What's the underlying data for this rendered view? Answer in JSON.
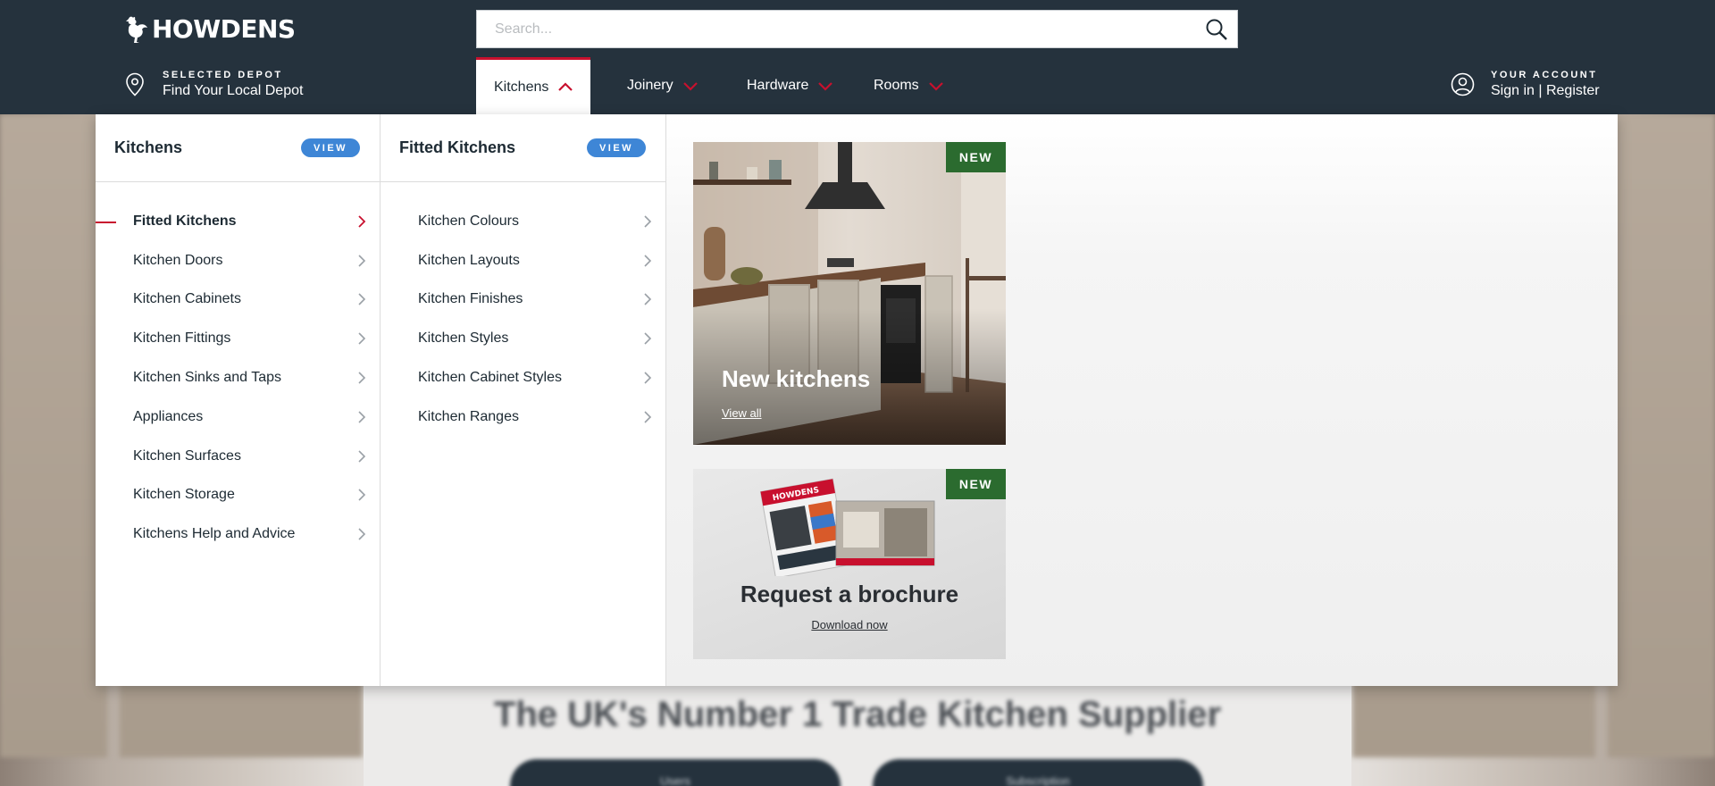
{
  "header": {
    "logo_text": "HOWDENS",
    "depot_label": "SELECTED DEPOT",
    "depot_link": "Find Your Local Depot",
    "search_placeholder": "Search...",
    "account_label": "YOUR ACCOUNT",
    "account_link": "Sign in | Register",
    "nav": [
      {
        "label": "Kitchens",
        "active": true
      },
      {
        "label": "Joinery"
      },
      {
        "label": "Hardware"
      },
      {
        "label": "Rooms"
      }
    ]
  },
  "menu": {
    "col1": {
      "title": "Kitchens",
      "view_label": "VIEW",
      "items": [
        "Fitted Kitchens",
        "Kitchen Doors",
        "Kitchen Cabinets",
        "Kitchen Fittings",
        "Kitchen Sinks and Taps",
        "Appliances",
        "Kitchen Surfaces",
        "Kitchen Storage",
        "Kitchens Help and Advice"
      ],
      "active_index": 0
    },
    "col2": {
      "title": "Fitted Kitchens",
      "view_label": "VIEW",
      "items": [
        "Kitchen Colours",
        "Kitchen Layouts",
        "Kitchen Finishes",
        "Kitchen Styles",
        "Kitchen Cabinet Styles",
        "Kitchen Ranges"
      ]
    },
    "cards": [
      {
        "badge": "NEW",
        "title": "New kitchens",
        "link": "View all"
      },
      {
        "badge": "NEW",
        "title": "Request a brochure",
        "link": "Download now",
        "brochure_text": "HOWDENS"
      }
    ]
  },
  "background": {
    "headline": "The UK's Number 1 Trade Kitchen Supplier",
    "buttons": [
      "Users",
      "Subscription"
    ]
  },
  "colors": {
    "header_bg": "#25323d",
    "accent_red": "#c8102e",
    "view_blue": "#3e86d6",
    "badge_green": "#2b6b2f"
  }
}
